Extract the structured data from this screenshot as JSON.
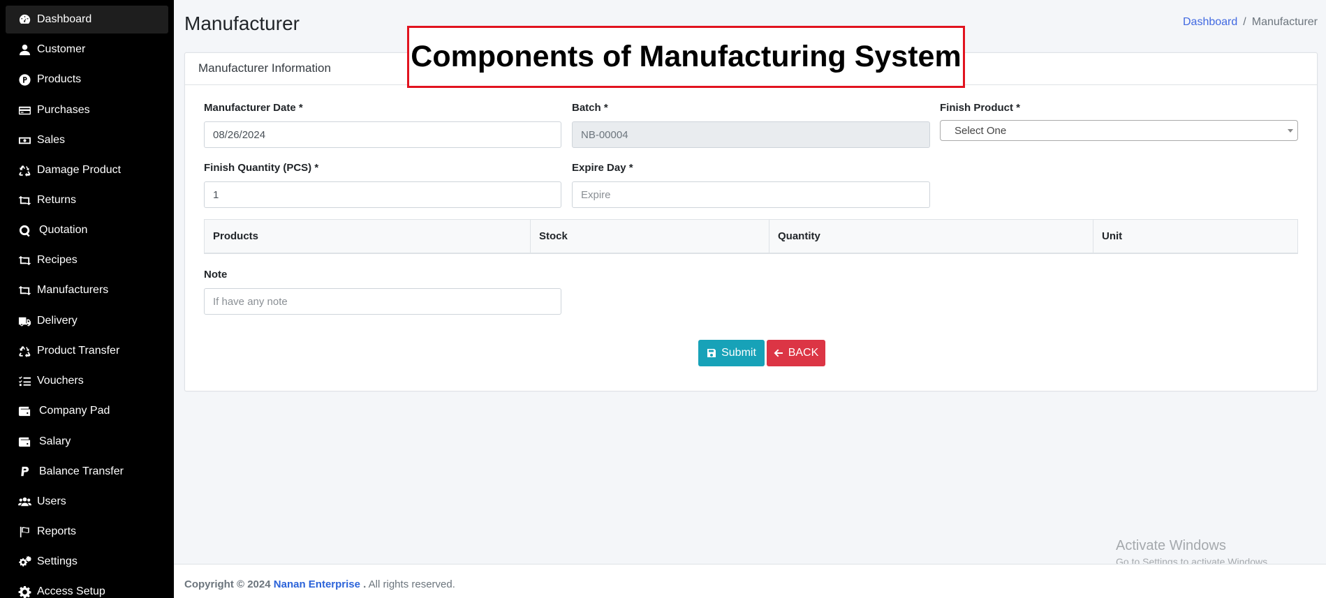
{
  "sidebar": {
    "items": [
      {
        "label": "Dashboard",
        "icon": "gauge-icon",
        "active": true
      },
      {
        "label": "Customer",
        "icon": "user-icon"
      },
      {
        "label": "Products",
        "icon": "product-p-icon"
      },
      {
        "label": "Purchases",
        "icon": "credit-card-icon"
      },
      {
        "label": "Sales",
        "icon": "money-bill-icon"
      },
      {
        "label": "Damage Product",
        "icon": "recycle-icon"
      },
      {
        "label": "Returns",
        "icon": "retweet-icon"
      },
      {
        "label": "Quotation",
        "icon": "quotation-q-icon"
      },
      {
        "label": "Recipes",
        "icon": "retweet-icon"
      },
      {
        "label": "Manufacturers",
        "icon": "retweet-icon"
      },
      {
        "label": "Delivery",
        "icon": "truck-icon"
      },
      {
        "label": "Product Transfer",
        "icon": "recycle-icon"
      },
      {
        "label": "Vouchers",
        "icon": "list-check-icon"
      },
      {
        "label": "Company Pad",
        "icon": "wallet-icon"
      },
      {
        "label": "Salary",
        "icon": "wallet-icon"
      },
      {
        "label": "Balance Transfer",
        "icon": "paypal-icon"
      },
      {
        "label": "Users",
        "icon": "users-icon"
      },
      {
        "label": "Reports",
        "icon": "flag-icon"
      },
      {
        "label": "Settings",
        "icon": "gears-icon"
      },
      {
        "label": "Access Setup",
        "icon": "gear-icon"
      }
    ]
  },
  "header": {
    "title": "Manufacturer",
    "breadcrumb": {
      "home": "Dashboard",
      "separator": "/",
      "current": "Manufacturer"
    }
  },
  "banner": {
    "text": "Components of Manufacturing System"
  },
  "form": {
    "card_title": "Manufacturer Information",
    "manufacturer_date": {
      "label": "Manufacturer Date *",
      "value": "08/26/2024"
    },
    "batch": {
      "label": "Batch *",
      "value": "NB-00004"
    },
    "finish_product": {
      "label": "Finish Product *",
      "value": "Select One"
    },
    "finish_quantity": {
      "label": "Finish Quantity (PCS) *",
      "value": "1"
    },
    "expire_day": {
      "label": "Expire Day *",
      "placeholder": "Expire"
    },
    "table_headers": [
      "Products",
      "Stock",
      "Quantity",
      "Unit"
    ],
    "note": {
      "label": "Note",
      "placeholder": "If have any note"
    },
    "submit_label": "Submit",
    "back_label": "BACK"
  },
  "watermark": {
    "line1": "Activate Windows",
    "line2": "Go to Settings to activate Windows."
  },
  "footer": {
    "copyright": "Copyright © 2024",
    "company": "Nanan Enterprise",
    "dot": " .",
    "rights": "All rights reserved."
  },
  "colors": {
    "sidebar_bg": "#000000",
    "accent_link": "#4169e1",
    "submit": "#17a2b8",
    "back": "#dc3545",
    "banner_border": "#e1131f"
  }
}
